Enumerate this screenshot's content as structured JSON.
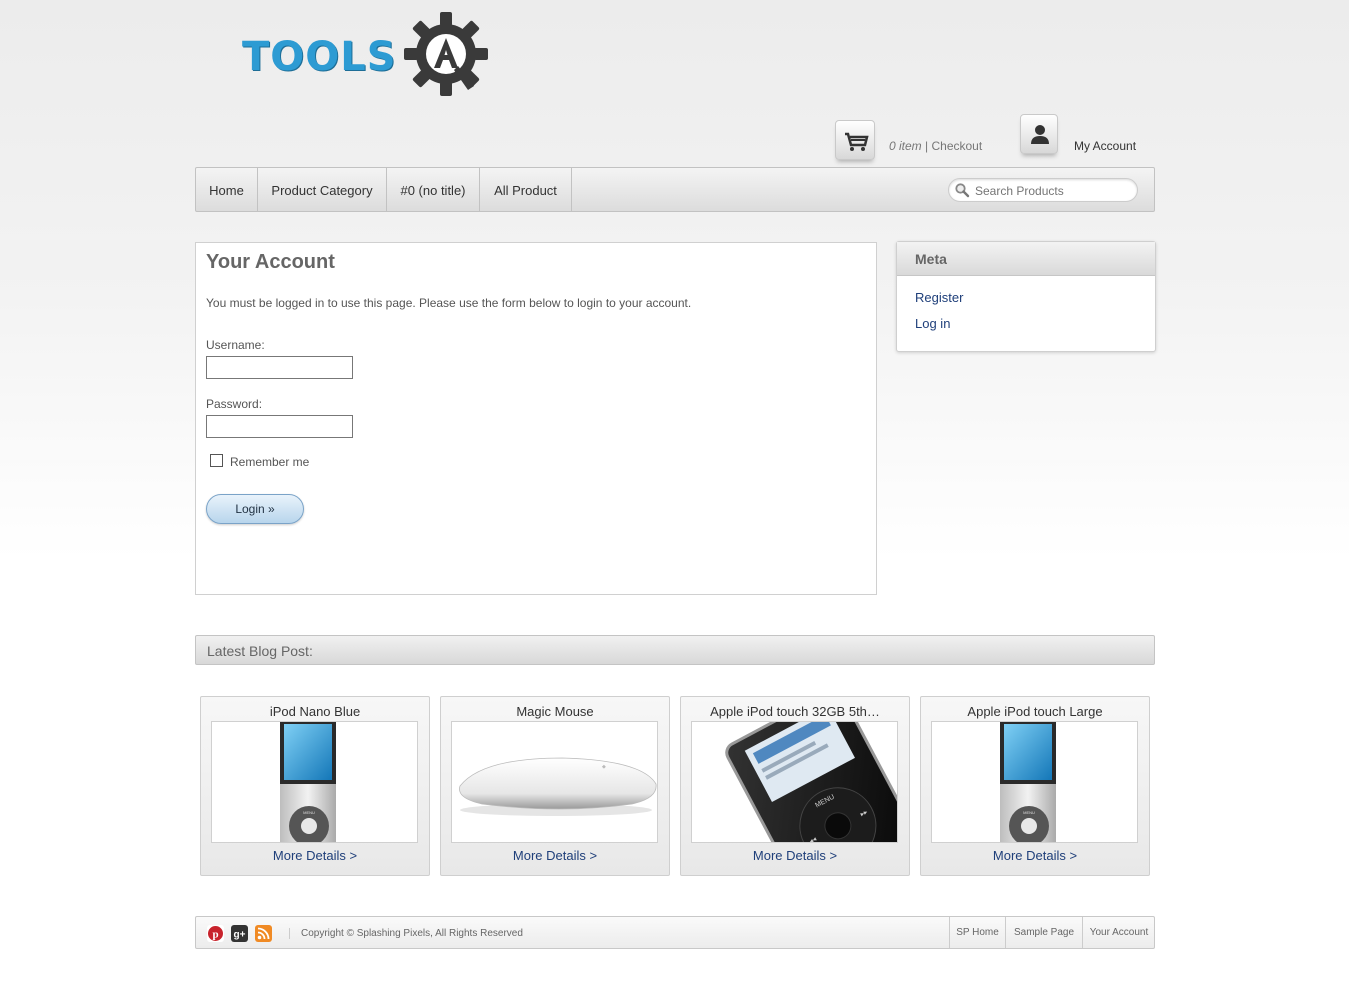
{
  "logo": {
    "text": "TOOLS",
    "letter": "A"
  },
  "header": {
    "cart_items": "0 item",
    "cart_separator": " | ",
    "checkout": "Checkout",
    "my_account": "My Account"
  },
  "nav": {
    "items": [
      {
        "label": "Home"
      },
      {
        "label": "Product Category"
      },
      {
        "label": "#0 (no title)"
      },
      {
        "label": "All Product"
      }
    ],
    "search_placeholder": "Search Products"
  },
  "account": {
    "title": "Your Account",
    "intro": "You must be logged in to use this page. Please use the form below to login to your account.",
    "username_label": "Username:",
    "username_value": "",
    "password_label": "Password:",
    "password_value": "",
    "remember_label": "Remember me",
    "remember_checked": false,
    "login_button": "Login »"
  },
  "meta": {
    "title": "Meta",
    "links": [
      {
        "label": "Register"
      },
      {
        "label": "Log in"
      }
    ]
  },
  "blog": {
    "title": "Latest Blog Post:",
    "products": [
      {
        "title": "iPod Nano Blue",
        "link": "More Details >",
        "image": "ipod-nano"
      },
      {
        "title": "Magic Mouse",
        "link": "More Details >",
        "image": "magic-mouse"
      },
      {
        "title": "Apple iPod touch 32GB 5th…",
        "link": "More Details >",
        "image": "ipod-classic"
      },
      {
        "title": "Apple iPod touch Large",
        "link": "More Details >",
        "image": "ipod-nano"
      }
    ]
  },
  "footer": {
    "social_icons": [
      "pinterest-icon",
      "google-plus-icon",
      "rss-icon"
    ],
    "copyright": "Copyright © Splashing Pixels, All Rights Reserved",
    "links": [
      {
        "label": "SP Home"
      },
      {
        "label": "Sample Page"
      },
      {
        "label": "Your Account"
      }
    ]
  },
  "colors": {
    "link": "#1f3f7a",
    "logo_blue": "#2d9bd3",
    "logo_gear": "#3a3a3a"
  }
}
